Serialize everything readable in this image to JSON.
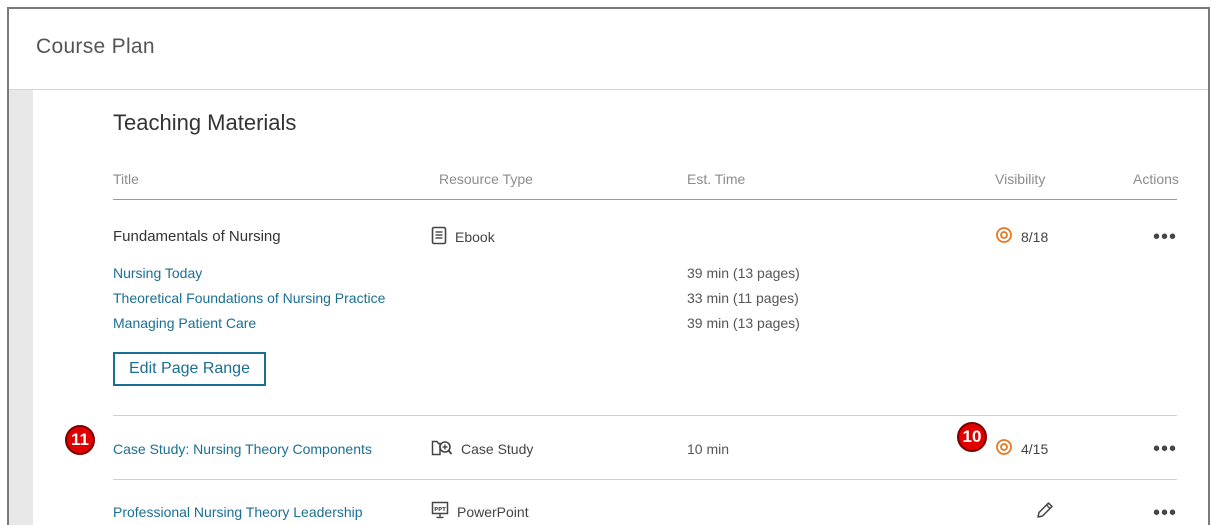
{
  "header": {
    "title": "Course Plan"
  },
  "section": {
    "title": "Teaching Materials"
  },
  "columns": {
    "title": "Title",
    "resource_type": "Resource Type",
    "est_time": "Est. Time",
    "visibility": "Visibility",
    "actions": "Actions"
  },
  "rows": {
    "ebook": {
      "title": "Fundamentals of Nursing",
      "resource_type": "Ebook",
      "resource_icon": "ebook-icon",
      "visibility": "8/18",
      "chapters": [
        {
          "title": "Nursing Today",
          "est_time": "39 min (13 pages)"
        },
        {
          "title": "Theoretical Foundations of Nursing Practice",
          "est_time": "33 min (11 pages)"
        },
        {
          "title": "Managing Patient Care",
          "est_time": "39 min (13 pages)"
        }
      ],
      "edit_button": "Edit Page Range"
    },
    "case_study": {
      "title": "Case Study: Nursing Theory Components",
      "resource_type": "Case Study",
      "resource_icon": "case-study-icon",
      "est_time": "10 min",
      "visibility": "4/15"
    },
    "powerpoint": {
      "title": "Professional Nursing Theory Leadership",
      "resource_type": "PowerPoint",
      "resource_icon": "powerpoint-icon",
      "visibility_icon": "pencil-icon"
    }
  },
  "actions_label": "•••",
  "callouts": {
    "left": "11",
    "right": "10"
  },
  "colors": {
    "link": "#1a6f93",
    "eye": "#e87722",
    "callout": "#e00000"
  }
}
